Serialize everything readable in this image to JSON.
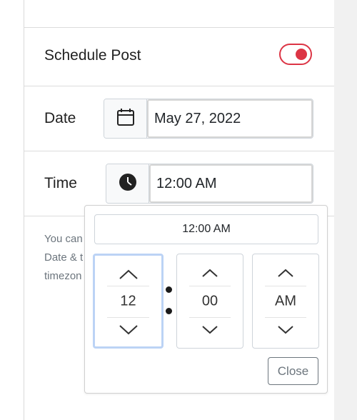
{
  "schedule": {
    "label": "Schedule Post",
    "enabled": true,
    "toggle_color": "#dc3545"
  },
  "date": {
    "label": "Date",
    "value": "May 27, 2022",
    "icon": "calendar-icon"
  },
  "time": {
    "label": "Time",
    "value": "12:00 AM",
    "icon": "clock-icon"
  },
  "help_text": {
    "line1": "You can",
    "line2": "Date & t",
    "line3": "timezon"
  },
  "time_picker": {
    "display": "12:00 AM",
    "hour": "12",
    "minute": "00",
    "period": "AM",
    "close_label": "Close",
    "focus_color": "#bcd3f5"
  }
}
